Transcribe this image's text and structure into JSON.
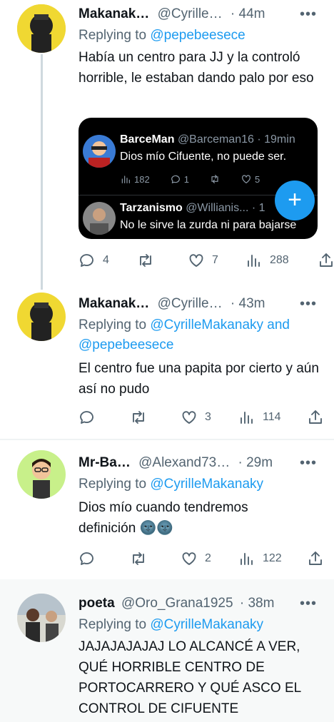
{
  "tweets": [
    {
      "name": "Makanak…",
      "handle": "@Cyrille…",
      "time": "· 44m",
      "replying_prefix": "Replying to",
      "replying_to": "@pepebeesece",
      "replying_joiner": "",
      "replying_to_2": "",
      "text": "Había un centro para JJ y la controló horrible, le estaban dando palo por eso",
      "stats": {
        "replies": "4",
        "retweets": "",
        "likes": "7",
        "views": "288"
      }
    },
    {
      "name": "Makanak…",
      "handle": "@Cyrille…",
      "time": "· 43m",
      "replying_prefix": "Replying to",
      "replying_to": "@CyrilleMakanaky",
      "replying_joiner": "and",
      "replying_to_2": "@pepebeesece",
      "text": "El centro fue una papita por cierto y aún así no pudo",
      "stats": {
        "replies": "",
        "retweets": "",
        "likes": "3",
        "views": "114"
      }
    },
    {
      "name": "Mr-Ba…",
      "handle": "@Alexand73…",
      "time": "· 29m",
      "replying_prefix": "Replying to",
      "replying_to": "@CyrilleMakanaky",
      "text": "Dios mío cuando tendremos definición",
      "emoji": "🌚🌚",
      "stats": {
        "replies": "",
        "retweets": "",
        "likes": "2",
        "views": "122"
      }
    },
    {
      "name": "poeta",
      "handle": "@Oro_Grana1925",
      "time": "· 38m",
      "replying_prefix": "Replying to",
      "replying_to": "@CyrilleMakanaky",
      "text": "JAJAJAJAJAJ LO ALCANCÉ A VER, QUÉ HORRIBLE CENTRO DE PORTOCARRERO Y QUÉ ASCO EL CONTROL DE CIFUENTE"
    }
  ],
  "quote": {
    "tweet1": {
      "name": "BarceMan",
      "handle": "@Barceman16",
      "time": "· 19min",
      "text": "Dios mío Cifuente, no puede ser.",
      "stats": {
        "views": "182",
        "replies": "1",
        "likes": "5"
      }
    },
    "tweet2": {
      "name": "Tarzanismo",
      "handle": "@Willianis...",
      "time": "· 1",
      "text": "No le sirve la zurda ni para bajarse"
    }
  },
  "more_label": "•••",
  "fab_label": "+",
  "colors": {
    "accent": "#1d9bf0",
    "muted": "#536471",
    "text": "#0f1419"
  }
}
